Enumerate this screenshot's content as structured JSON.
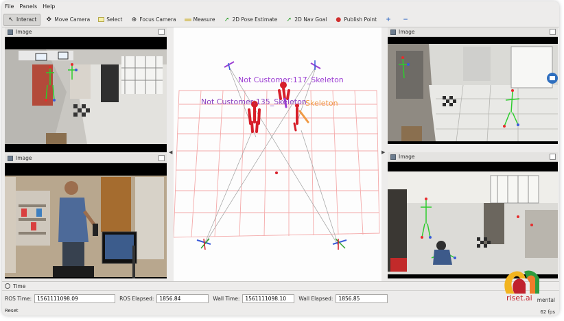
{
  "menu": [
    "File",
    "Panels",
    "Help"
  ],
  "toolbar": {
    "interact": "Interact",
    "move_camera": "Move Camera",
    "select": "Select",
    "focus_camera": "Focus Camera",
    "measure": "Measure",
    "pose_estimate": "2D Pose Estimate",
    "nav_goal": "2D Nav Goal",
    "publish_point": "Publish Point"
  },
  "panels": {
    "top_left": "Image",
    "bottom_left": "Image",
    "top_right": "Image",
    "bottom_right": "Image"
  },
  "viz": {
    "label1": "Not  Customer:117_Skeleton",
    "label2": "Not  Customer:135_Skeleton",
    "label3": "Skeleton"
  },
  "time": {
    "title": "Time",
    "ros_time_label": "ROS Time:",
    "ros_time": "1561111098.09",
    "ros_elapsed_label": "ROS Elapsed:",
    "ros_elapsed": "1856.84",
    "wall_time_label": "Wall Time:",
    "wall_time": "1561111098.10",
    "wall_elapsed_label": "Wall Elapsed:",
    "wall_elapsed": "1856.85",
    "experimental": "mental",
    "reset": "Reset",
    "fps": "62 fps"
  },
  "brand": {
    "name": "riset.ai"
  },
  "colors": {
    "purple": "#9c3fd3",
    "orange": "#f09a45",
    "grid": "#f4a9a9",
    "skeleton_red": "#d71f2a"
  }
}
